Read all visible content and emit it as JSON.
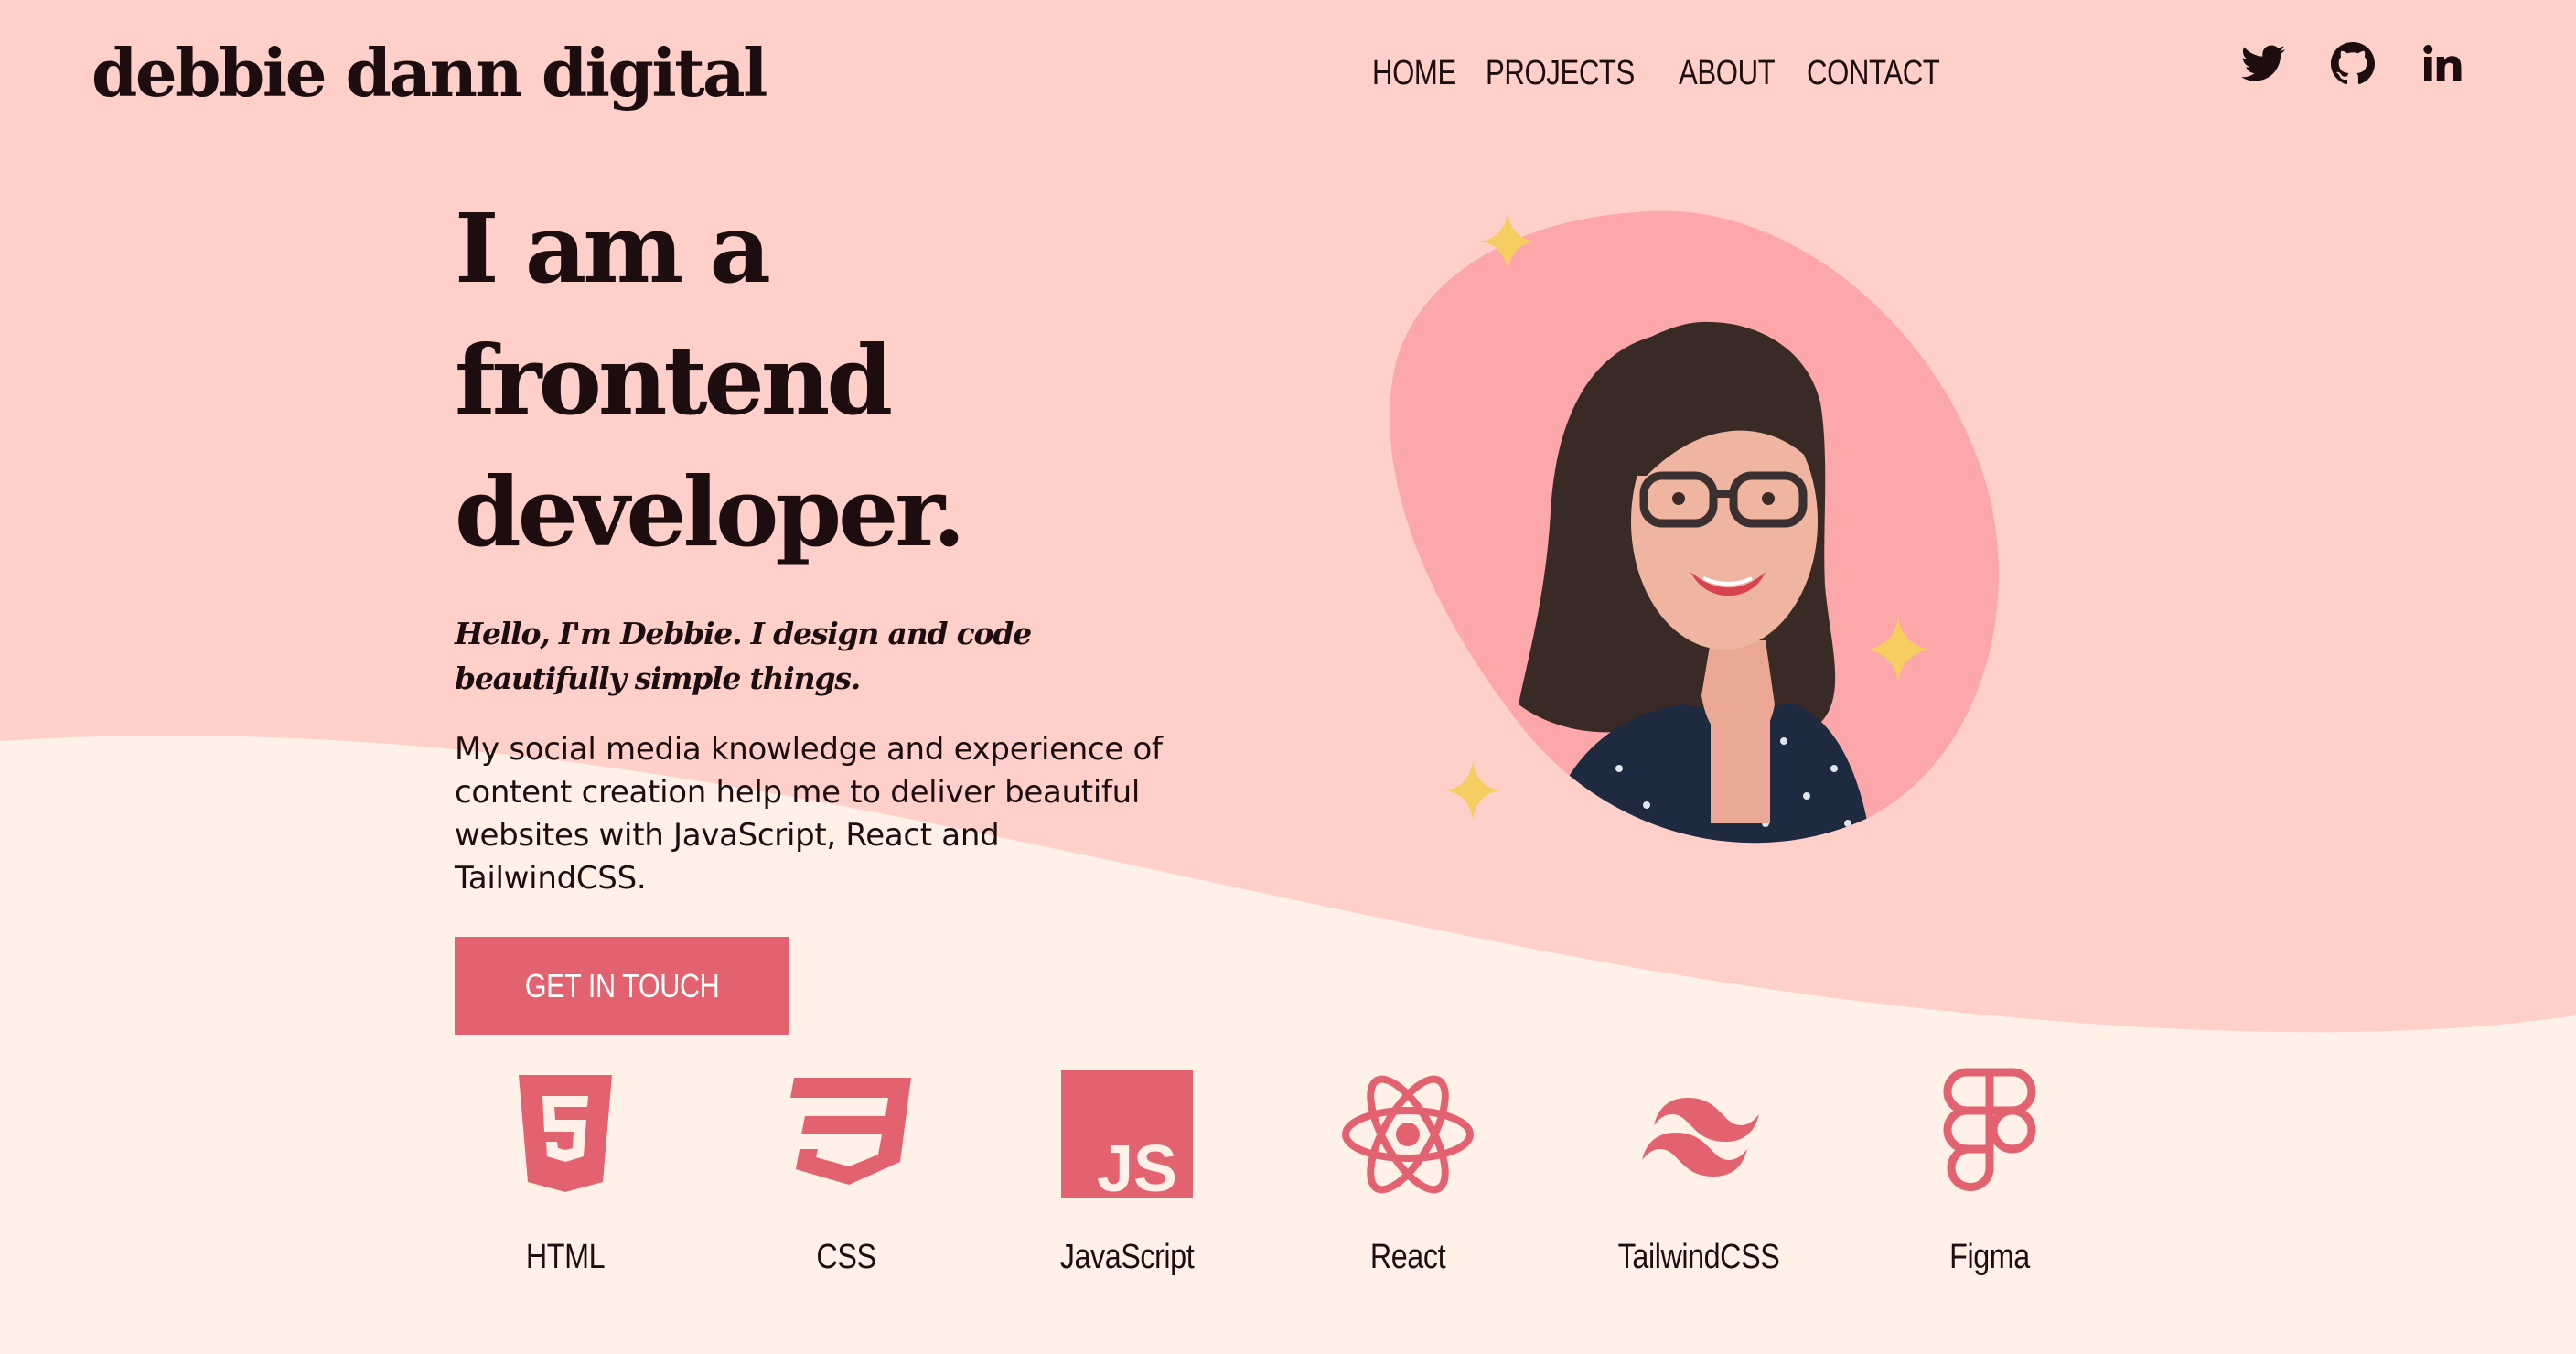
{
  "site": {
    "logo": "debbie dann digital"
  },
  "nav": {
    "items": [
      "HOME",
      "PROJECTS",
      "ABOUT",
      "CONTACT"
    ]
  },
  "social": [
    {
      "icon": "twitter-icon"
    },
    {
      "icon": "github-icon"
    },
    {
      "icon": "linkedin-icon"
    }
  ],
  "hero": {
    "headline_line1": "I am a frontend",
    "headline_line2": "developer.",
    "tagline": "Hello, I'm Debbie. I design and code beautifully simple things.",
    "description": "My social media knowledge and experience of content creation help me to deliver beautiful websites with JavaScript, React and TailwindCSS.",
    "cta_label": "GET IN TOUCH"
  },
  "tech": [
    {
      "label": "HTML",
      "icon": "html5-icon"
    },
    {
      "label": "CSS",
      "icon": "css3-icon"
    },
    {
      "label": "JavaScript",
      "icon": "javascript-icon"
    },
    {
      "label": "React",
      "icon": "react-icon"
    },
    {
      "label": "TailwindCSS",
      "icon": "tailwindcss-icon"
    },
    {
      "label": "Figma",
      "icon": "figma-icon"
    }
  ],
  "colors": {
    "hero_bg": "#ffd0ca",
    "page_bg": "#fff0e8",
    "accent": "#e2636f",
    "blob": "#fca7aa",
    "sparkle": "#f5cd60",
    "text": "#1d0d0e"
  }
}
